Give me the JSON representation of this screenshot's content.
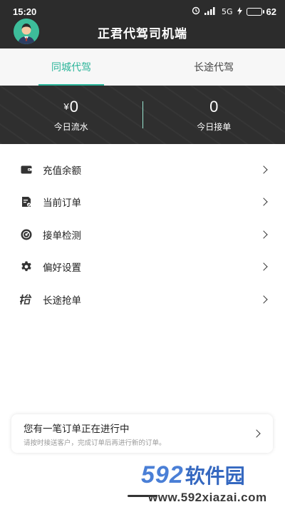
{
  "status_bar": {
    "time": "15:20",
    "signal_text": "5G",
    "battery_level": 62,
    "battery_text": "62"
  },
  "header": {
    "title": "正君代驾司机端",
    "avatar_icon": "driver-avatar"
  },
  "tabs": [
    {
      "label": "同城代驾",
      "active": true
    },
    {
      "label": "长途代驾",
      "active": false
    }
  ],
  "stats": {
    "flow": {
      "currency": "¥",
      "value": "0",
      "label": "今日流水"
    },
    "orders": {
      "value": "0",
      "label": "今日接单"
    }
  },
  "menu": [
    {
      "label": "充值余额",
      "icon": "wallet-icon"
    },
    {
      "label": "当前订单",
      "icon": "order-doc-icon"
    },
    {
      "label": "接单检测",
      "icon": "radar-icon"
    },
    {
      "label": "偏好设置",
      "icon": "gear-icon"
    },
    {
      "label": "长途抢单",
      "icon": "grab-order-icon"
    }
  ],
  "order_banner": {
    "title": "您有一笔订单正在进行中",
    "subtitle": "请按时接送客户，完成订单后再进行新的订单。"
  },
  "watermark": {
    "number": "592",
    "text": "软件园",
    "url": "www.592xiazai.com"
  },
  "colors": {
    "accent": "#2bb59a",
    "header_bg": "#2c2c2c",
    "stats_bg": "#2f2f2f"
  }
}
